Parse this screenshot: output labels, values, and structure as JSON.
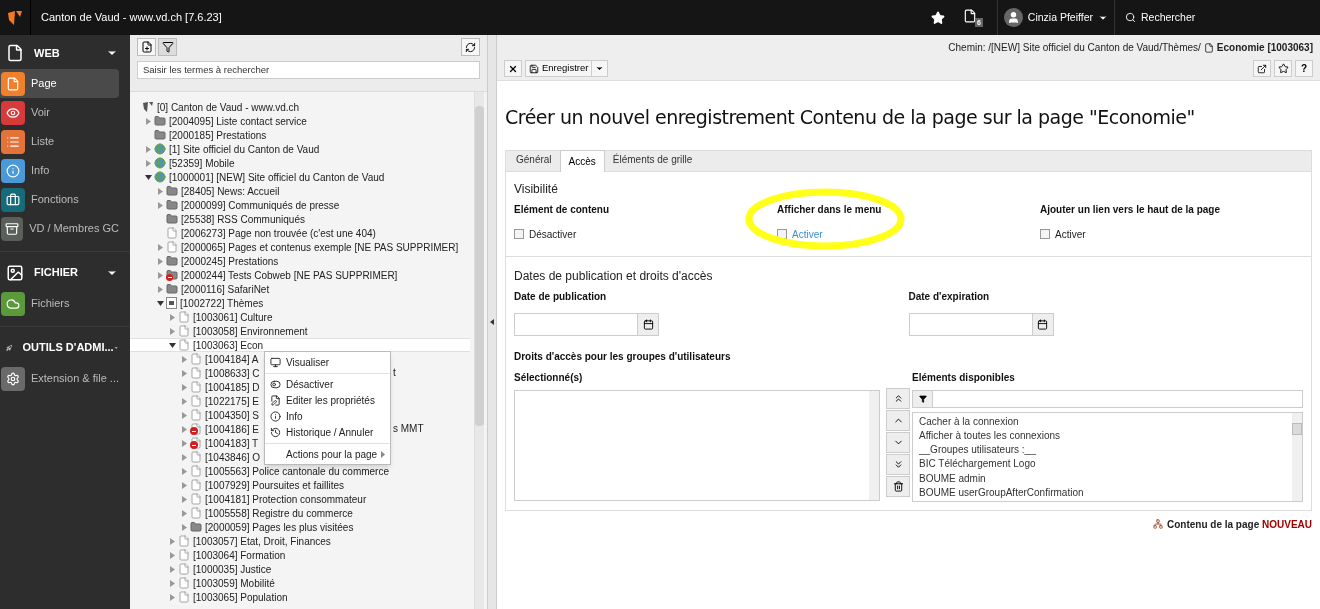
{
  "topbar": {
    "title": "Canton de Vaud - www.vd.ch [7.6.23]",
    "badge": "6",
    "user": "Cinzia Pfeiffer",
    "search": "Rechercher"
  },
  "sidebar": [
    {
      "kind": "group",
      "label": "WEB"
    },
    {
      "kind": "item",
      "label": "Page",
      "color": "#f0802c",
      "selected": true
    },
    {
      "kind": "item",
      "label": "Voir",
      "color": "#d63a3a",
      "selected": false
    },
    {
      "kind": "item",
      "label": "Liste",
      "color": "#e4733a",
      "selected": false
    },
    {
      "kind": "item",
      "label": "Info",
      "color": "#4a99d8",
      "selected": false
    },
    {
      "kind": "item",
      "label": "Fonctions",
      "color": "#166b7a",
      "selected": false
    },
    {
      "kind": "item",
      "label": "VD / Membres GC",
      "color": "#5a5f5a",
      "selected": false
    },
    {
      "kind": "group",
      "label": "FICHIER"
    },
    {
      "kind": "item",
      "label": "Fichiers",
      "color": "#5a9a3a",
      "selected": false
    },
    {
      "kind": "group",
      "label": "OUTILS D'ADMI..."
    },
    {
      "kind": "item",
      "label": "Extension & file ...",
      "color": "#6a6a6a",
      "selected": false
    }
  ],
  "tree": {
    "search_placeholder": "Saisir les termes à rechercher",
    "items": [
      {
        "label": "[0] Canton de Vaud - www.vd.ch",
        "kind": "root",
        "selected": false,
        "children": [
          {
            "label": "[2004095] Liste contact service",
            "kind": "folder",
            "expanded": false,
            "selected": false
          },
          {
            "label": "[2000185] Prestations",
            "kind": "folder",
            "selected": false
          },
          {
            "label": "[1] Site officiel du Canton de Vaud",
            "kind": "globe",
            "expanded": false,
            "selected": false
          },
          {
            "label": "[52359] Mobile",
            "kind": "globe",
            "expanded": false,
            "selected": false
          },
          {
            "label": "[1000001] [NEW] Site officiel du Canton de Vaud",
            "kind": "globe",
            "expanded": true,
            "selected": false,
            "children": [
              {
                "label": "[28405] News: Accueil",
                "kind": "folder",
                "expanded": false,
                "selected": false
              },
              {
                "label": "[2000099] Communiqués de presse",
                "kind": "folder",
                "expanded": false,
                "selected": false
              },
              {
                "label": "[25538] RSS Communiqués",
                "kind": "folder",
                "selected": false
              },
              {
                "label": "[2006273] Page non trouvée (c'est une 404)",
                "kind": "page",
                "selected": false
              },
              {
                "label": "[2000065] Pages et contenus exemple [NE PAS SUPPRIMER]",
                "kind": "page",
                "expanded": false,
                "selected": false
              },
              {
                "label": "[2000245] Prestations",
                "kind": "folder",
                "expanded": false,
                "selected": false
              },
              {
                "label": "[2000244] Tests Cobweb [NE PAS SUPPRIMER]",
                "kind": "blockedfolder",
                "expanded": false,
                "selected": false
              },
              {
                "label": "[2000116] SafariNet",
                "kind": "folder",
                "expanded": false,
                "selected": false
              },
              {
                "label": "[1002722] Thèmes",
                "kind": "special",
                "expanded": true,
                "selected": false,
                "children": [
                  {
                    "label": "[1003061] Culture",
                    "kind": "page",
                    "expanded": false,
                    "selected": false
                  },
                  {
                    "label": "[1003058] Environnement",
                    "kind": "page",
                    "expanded": false,
                    "selected": false
                  },
                  {
                    "label": "[1003063] Econ",
                    "kind": "page",
                    "expanded": true,
                    "selected": true,
                    "children": [
                      {
                        "label": "[1004184] A",
                        "kind": "page",
                        "expanded": false,
                        "selected": false
                      },
                      {
                        "label": "[1008633] C",
                        "tail": "t",
                        "kind": "page",
                        "expanded": false,
                        "selected": false
                      },
                      {
                        "label": "[1004185] D",
                        "kind": "page",
                        "expanded": false,
                        "selected": false
                      },
                      {
                        "label": "[1022175] E",
                        "kind": "page",
                        "expanded": false,
                        "selected": false
                      },
                      {
                        "label": "[1004350] S",
                        "kind": "page",
                        "expanded": false,
                        "selected": false
                      },
                      {
                        "label": "[1004186] E",
                        "tail": "s MMT",
                        "kind": "blockedpage",
                        "expanded": false,
                        "selected": false
                      },
                      {
                        "label": "[1004183] T",
                        "kind": "blockedpage",
                        "expanded": false,
                        "selected": false
                      },
                      {
                        "label": "[1043846] O",
                        "kind": "page",
                        "expanded": false,
                        "selected": false
                      },
                      {
                        "label": "[1005563] Police cantonale du commerce",
                        "kind": "page",
                        "expanded": false,
                        "selected": false
                      },
                      {
                        "label": "[1007929] Poursuites et faillites",
                        "kind": "page",
                        "expanded": false,
                        "selected": false
                      },
                      {
                        "label": "[1004181] Protection consommateur",
                        "kind": "page",
                        "expanded": false,
                        "selected": false
                      },
                      {
                        "label": "[1005558] Registre du commerce",
                        "kind": "page",
                        "expanded": false,
                        "selected": false
                      },
                      {
                        "label": "[2000059] Pages les plus visitées",
                        "kind": "folder",
                        "expanded": false,
                        "selected": false
                      }
                    ]
                  },
                  {
                    "label": "[1003057] Etat, Droit, Finances",
                    "kind": "page",
                    "expanded": false,
                    "selected": false
                  },
                  {
                    "label": "[1003064] Formation",
                    "kind": "page",
                    "expanded": false,
                    "selected": false
                  },
                  {
                    "label": "[1000035] Justice",
                    "kind": "page",
                    "expanded": false,
                    "selected": false
                  },
                  {
                    "label": "[1003059] Mobilité",
                    "kind": "page",
                    "expanded": false,
                    "selected": false
                  },
                  {
                    "label": "[1003065] Population",
                    "kind": "page",
                    "expanded": false,
                    "selected": false
                  }
                ]
              }
            ]
          }
        ]
      }
    ]
  },
  "context_menu": [
    {
      "label": "Visualiser",
      "kind": "action",
      "divider_after": true
    },
    {
      "label": "Désactiver",
      "kind": "action",
      "divider_after": false
    },
    {
      "label": "Editer les propriétés",
      "kind": "action",
      "divider_after": false
    },
    {
      "label": "Info",
      "kind": "action",
      "divider_after": false
    },
    {
      "label": "Historique / Annuler",
      "kind": "action",
      "divider_after": true
    },
    {
      "label": "Actions pour la page",
      "kind": "submenu",
      "divider_after": false
    }
  ],
  "docheader": {
    "path": "Chemin: /[NEW] Site officiel du Canton de Vaud/Thèmes/",
    "page": "Economie [1003063]",
    "save": "Enregistrer",
    "help": "?"
  },
  "form": {
    "title": "Créer un nouvel enregistrement Contenu de la page sur la page \"Economie\"",
    "tabs": [
      {
        "label": "Général",
        "selected": false
      },
      {
        "label": "Accès",
        "selected": true
      },
      {
        "label": "Éléments de grille",
        "selected": false
      }
    ],
    "visibility": {
      "heading": "Visibilité",
      "fields": [
        {
          "label": "Elément de contenu",
          "option": "Désactiver",
          "checked": false,
          "link": false,
          "highlighted": false
        },
        {
          "label": "Afficher dans le menu",
          "option": "Activer",
          "checked": false,
          "link": true,
          "highlighted": true
        },
        {
          "label": "Ajouter un lien vers le haut de la page",
          "option": "Activer",
          "checked": false,
          "link": false,
          "highlighted": false
        }
      ]
    },
    "dates": {
      "heading": "Dates de publication et droits d'accès",
      "fields": [
        {
          "label": "Date de publication"
        },
        {
          "label": "Date d'expiration"
        }
      ]
    },
    "access": {
      "heading": "Droits d'accès pour les groupes d'utilisateurs",
      "selected_label": "Sélectionné(s)",
      "available_label": "Eléments disponibles",
      "available": [
        "Cacher à la connexion",
        "Afficher à toutes les connexions",
        "__Groupes utilisateurs :__",
        "BIC Téléchargement Logo",
        "BOUME admin",
        "BOUME userGroupAfterConfirmation"
      ]
    },
    "footer": {
      "text": "Contenu de la page",
      "status": "NOUVEAU"
    }
  }
}
